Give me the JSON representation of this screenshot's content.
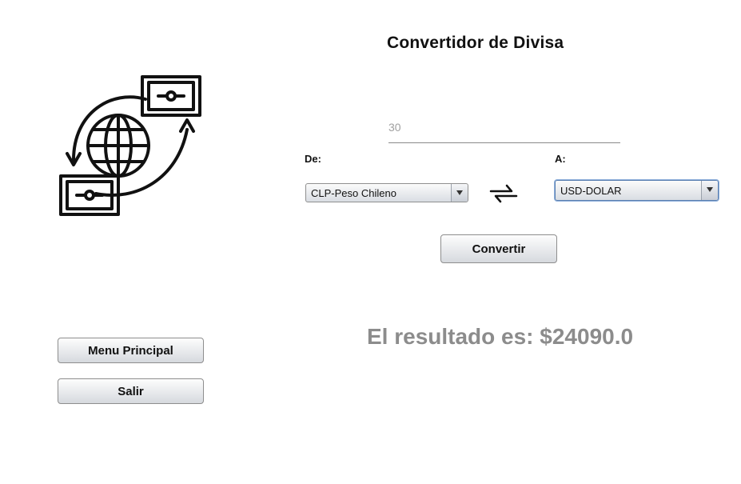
{
  "header": {
    "title": "Convertidor de Divisa"
  },
  "logo": {
    "icon": "currency-exchange-globe-icon"
  },
  "amount": {
    "placeholder": "30",
    "value": ""
  },
  "from": {
    "label": "De:",
    "selected": "CLP-Peso Chileno"
  },
  "to": {
    "label": "A:",
    "selected": "USD-DOLAR"
  },
  "swap": {
    "icon": "swap-arrows-icon"
  },
  "actions": {
    "convert_label": "Convertir",
    "menu_label": "Menu Principal",
    "exit_label": "Salir"
  },
  "result": {
    "text": "El resultado es: $24090.0"
  },
  "colors": {
    "result_text": "#8c8c8c",
    "focused_border": "#5a7fb0"
  }
}
